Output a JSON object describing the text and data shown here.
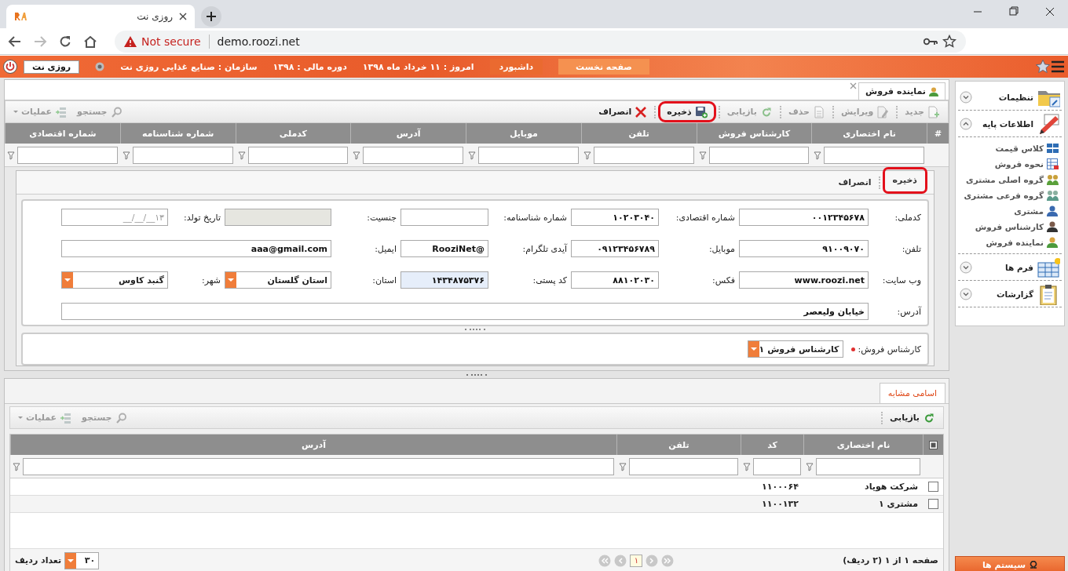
{
  "browser": {
    "tab_title": "روزی نت",
    "security": "Not secure",
    "url": "demo.roozi.net"
  },
  "header": {
    "nav": [
      {
        "label": "صفحه نخست",
        "selected": true
      },
      {
        "label": "داشبورد",
        "selected": false
      }
    ],
    "info": [
      "امروز : ۱۱ خرداد ماه ۱۳۹۸",
      "دوره مالی : ۱۳۹۸",
      "سازمان : صنایع غذایی روزی نت"
    ],
    "user": "روزی نت"
  },
  "record_panel": {
    "tab_title": "نماینده فروش",
    "toolbar": [
      {
        "label": "جدید",
        "kind": "new",
        "disabled": true,
        "highlighted": false
      },
      {
        "label": "ویرایش",
        "kind": "edit",
        "disabled": true,
        "highlighted": false
      },
      {
        "label": "حذف",
        "kind": "delete",
        "disabled": true,
        "highlighted": false
      },
      {
        "label": "بازیابی",
        "kind": "refresh",
        "disabled": true,
        "highlighted": false
      },
      {
        "label": "ذخیره",
        "kind": "save",
        "disabled": false,
        "highlighted": true
      },
      {
        "label": "انصراف",
        "kind": "cancel",
        "disabled": false,
        "highlighted": false
      }
    ],
    "tools": [
      {
        "label": "جستجو",
        "kind": "search",
        "disabled": true
      },
      {
        "label": "عملیات",
        "kind": "actions",
        "disabled": true
      }
    ],
    "columns": [
      "#",
      "نام اختصاری",
      "کارشناس فروش",
      "تلفن",
      "موبایل",
      "آدرس",
      "کدملی",
      "شماره شناسنامه",
      "شماره اقتصادی"
    ],
    "form_actions": [
      {
        "label": "ذخیره",
        "highlighted": true
      },
      {
        "label": "انصراف",
        "highlighted": false
      }
    ],
    "fields": [
      [
        {
          "label": "کدملی:",
          "kind": "text",
          "value": "۰۰۱۲۳۴۵۶۷۸",
          "disabled": false,
          "focused": false
        },
        {
          "label": "شماره اقتصادی:",
          "kind": "text",
          "value": "۱۰۲۰۳۰۴۰",
          "disabled": false,
          "focused": false
        },
        {
          "label": "شماره شناسنامه:",
          "kind": "text",
          "disabled": false,
          "focused": false
        },
        {
          "label": "جنسیت:",
          "kind": "text",
          "disabled": true,
          "focused": false
        },
        {
          "label": "تاریخ تولد:",
          "kind": "text",
          "placeholder": "۱۳__/__/__",
          "disabled": false,
          "focused": false
        }
      ],
      [
        {
          "label": "تلفن:",
          "kind": "text",
          "value": "۹۱۰۰۹۰۷۰",
          "disabled": false,
          "focused": false
        },
        {
          "label": "موبایل:",
          "kind": "text",
          "value": "۰۹۱۲۳۴۵۶۷۸۹",
          "disabled": false,
          "focused": false
        },
        {
          "label": "آیدی تلگرام:",
          "kind": "text",
          "value": "@RooziNet",
          "disabled": false,
          "focused": false
        },
        {
          "label": "ایمیل:",
          "kind": "text",
          "value": "aaa@gmail.com",
          "disabled": false,
          "focused": false
        }
      ],
      [
        {
          "label": "وب سایت:",
          "kind": "text",
          "value": "www.roozi.net",
          "disabled": false,
          "focused": false
        },
        {
          "label": "فکس:",
          "kind": "text",
          "value": "۸۸۱۰۲۰۳۰",
          "disabled": false,
          "focused": false
        },
        {
          "label": "کد پستی:",
          "kind": "text",
          "value": "۱۴۳۴۸۷۵۳۷۶",
          "disabled": false,
          "focused": true
        },
        {
          "label": "استان:",
          "kind": "select",
          "value": "استان گلستان",
          "disabled": false,
          "focused": false
        },
        {
          "label": "شهر:",
          "kind": "select",
          "value": "گنبد کاوس",
          "disabled": false,
          "focused": false
        }
      ],
      [
        {
          "label": "آدرس:",
          "kind": "text",
          "value": "خیابان ولیعصر",
          "disabled": false,
          "focused": false
        }
      ]
    ],
    "expert": {
      "label": "کارشناس فروش:",
      "required": true,
      "value": "کارشناس فروش ۱"
    }
  },
  "similar_panel": {
    "tab_title": "اسامی مشابه",
    "toolbar": [
      {
        "label": "بازیابی",
        "kind": "refresh",
        "disabled": false
      }
    ],
    "tools": [
      {
        "label": "جستجو",
        "kind": "search",
        "disabled": true
      },
      {
        "label": "عملیات",
        "kind": "actions",
        "disabled": true
      }
    ],
    "select_all": {
      "checked": false
    },
    "columns": [
      "نام اختصاری",
      "کد",
      "تلفن",
      "آدرس"
    ],
    "rows": [
      {
        "name": "شرکت هویاد",
        "code": "۱۱۰۰۰۶۴",
        "checked": false
      },
      {
        "name": "مشتری ۱",
        "code": "۱۱۰۰۱۳۲",
        "checked": false
      }
    ],
    "pager": {
      "summary": "صفحه ۱ از ۱ (۲ ردیف)",
      "page": "۱",
      "page_size_label": "تعداد ردیف",
      "page_size": "۳۰"
    }
  },
  "sidebar": {
    "sections": [
      {
        "label": "تنظیمات",
        "kind": "settings",
        "expanded": false
      },
      {
        "label": "اطلاعات پایه",
        "kind": "base",
        "expanded": true,
        "items": [
          {
            "label": "کلاس قیمت",
            "kind": "grid"
          },
          {
            "label": "نحوه فروش",
            "kind": "table"
          },
          {
            "label": "گروه اصلی مشتری",
            "kind": "group"
          },
          {
            "label": "گروه فرعی مشتری",
            "kind": "subgroup"
          },
          {
            "label": "مشتری",
            "kind": "person"
          },
          {
            "label": "کارشناس فروش",
            "kind": "expert"
          },
          {
            "label": "نماینده فروش",
            "kind": "agent"
          }
        ]
      },
      {
        "label": "فرم ها",
        "kind": "forms",
        "expanded": false
      },
      {
        "label": "گزارشات",
        "kind": "reports",
        "expanded": false
      }
    ],
    "footer": "سیستم ها"
  }
}
